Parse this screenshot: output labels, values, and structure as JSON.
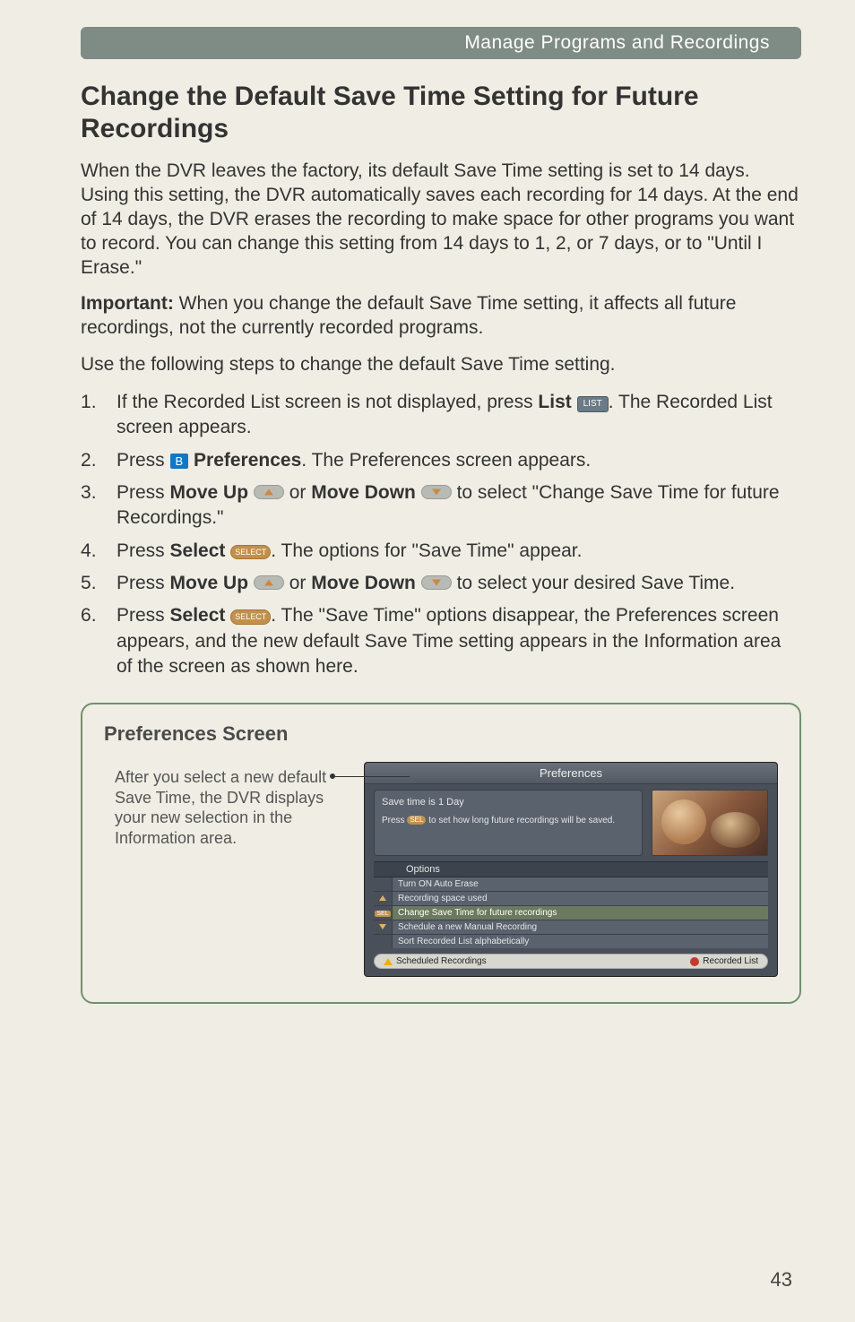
{
  "header": {
    "title": "Manage Programs and Recordings"
  },
  "page": {
    "heading": "Change the Default Save Time Setting for Future Recordings",
    "intro": "When the DVR leaves the factory, its default Save Time setting is set to 14 days. Using this setting, the DVR automatically saves each recording for 14 days. At the end of 14 days, the DVR erases the recording to make space for other programs you want to record. You can change this setting from 14 days to 1, 2, or 7 days, or to \"Until I Erase.\"",
    "important_label": "Important:",
    "important_text": " When you change the default Save Time setting, it affects all future recordings, not the currently recorded programs.",
    "lead_in": "Use the following steps to change the default Save Time setting.",
    "steps": {
      "s1a": "If the Recorded List screen is not displayed, press ",
      "s1_bold": "List",
      "s1_btn": "LIST",
      "s1b": ". The Recorded List screen appears.",
      "s2a": "Press ",
      "s2_btn": "B",
      "s2_bold": " Preferences",
      "s2b": ". The Preferences screen appears.",
      "s3a": "Press ",
      "s3_b1": "Move Up",
      "s3_mid": " or ",
      "s3_b2": "Move Down",
      "s3b": " to select \"Change Save Time for future Recordings.\"",
      "s4a": "Press ",
      "s4_bold": "Select",
      "s4_btn": "SELECT",
      "s4b": ". The options for \"Save Time\" appear.",
      "s5a": "Press ",
      "s5_b1": "Move Up",
      "s5_mid": " or ",
      "s5_b2": "Move Down",
      "s5b": " to select your desired Save Time.",
      "s6a": "Press ",
      "s6_bold": "Select",
      "s6_btn": "SELECT",
      "s6b": ". The \"Save Time\" options disappear, the Preferences screen appears, and the new default Save Time setting appears in the Information area of the screen as shown here."
    }
  },
  "screen": {
    "title": "Preferences Screen",
    "callout": "After you select a new default Save Time, the DVR displays your new selection in the Information area.",
    "panel_title": "Preferences",
    "info_line1": "Save time is 1 Day",
    "info_pre": "Press ",
    "info_sel": "SEL",
    "info_rest": " to set how long future recordings will be saved.",
    "options_header": "Options",
    "options": [
      "Turn ON Auto Erase",
      "Recording space used",
      "Change Save Time for future recordings",
      "Schedule a new Manual Recording",
      "Sort Recorded List alphabetically"
    ],
    "knob_sel": "SEL",
    "footer_left": "Scheduled Recordings",
    "footer_right": "Recorded List"
  },
  "page_number": "43"
}
